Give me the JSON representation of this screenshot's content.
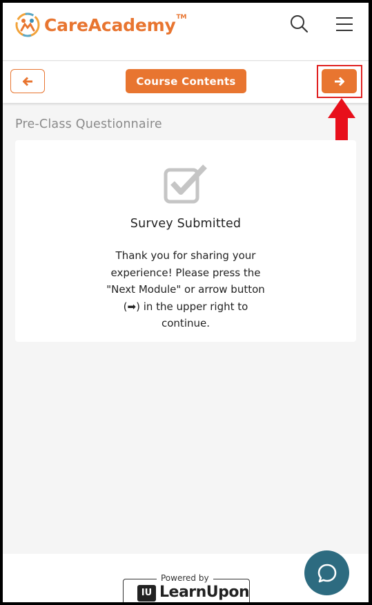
{
  "header": {
    "brand_care": "Care",
    "brand_academy": "Academy",
    "brand_tm": "TM",
    "icons": [
      "search-icon",
      "menu-icon"
    ]
  },
  "toolbar": {
    "back_icon": "arrow-left-icon",
    "course_contents_label": "Course Contents",
    "next_icon": "arrow-right-icon"
  },
  "content": {
    "section_title": "Pre-Class Questionnaire",
    "card": {
      "icon": "checkbox-checked-icon",
      "title": "Survey Submitted",
      "body": "Thank you for sharing your experience! Please press the \"Next Module\" or arrow button (➡) in the upper right to continue."
    }
  },
  "footer": {
    "powered_by": "Powered by",
    "learnupon": "LearnUpon"
  },
  "colors": {
    "accent": "#e87530",
    "highlight": "#e02020",
    "chat": "#2d6b80"
  }
}
